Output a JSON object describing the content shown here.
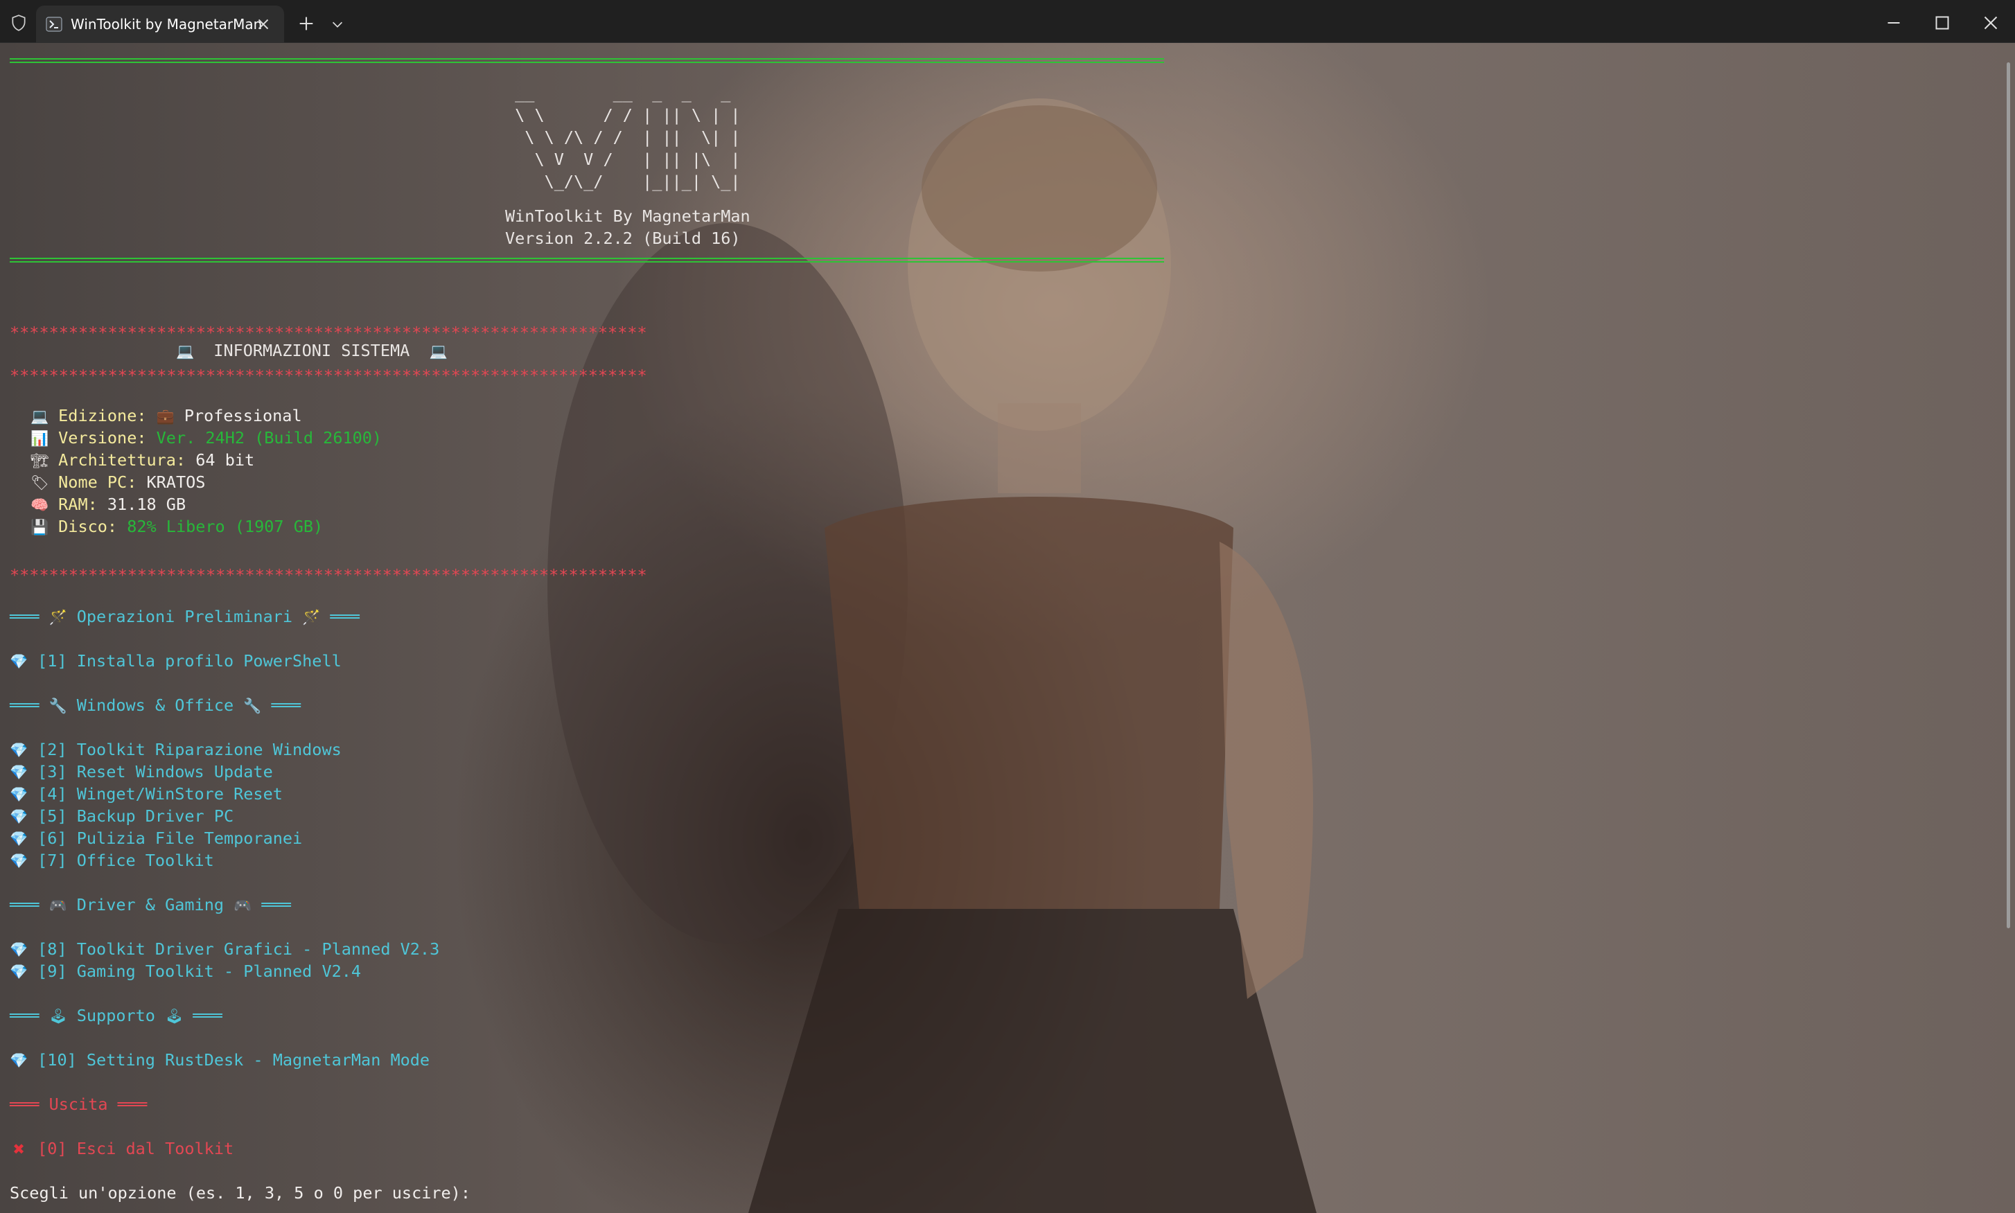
{
  "window": {
    "tab_title": "WinToolkit by MagnetarMan",
    "new_tab": "+",
    "tab_menu": "⌄"
  },
  "banner": {
    "ascii_art": [
      " __        __  _  _   _ ",
      " \\ \\      / / | || \\ | |",
      "  \\ \\ /\\ / /  | ||  \\| |",
      "   \\ V  V /   | || |\\  |",
      "    \\_/\\_/    |_||_| \\_|"
    ],
    "title": "WinToolkit By MagnetarMan",
    "version": "Version 2.2.2 (Build 16)"
  },
  "sysinfo": {
    "stars": "*****************************************************************",
    "heading": "INFORMAZIONI SISTEMA",
    "rows": [
      {
        "icon": "laptop-icon",
        "label": "Edizione:",
        "prefix_icon": "briefcase-icon",
        "value": "Professional",
        "color": "white"
      },
      {
        "icon": "chart-icon",
        "label": "Versione:",
        "value": "Ver. 24H2 (Build 26100)",
        "color": "green"
      },
      {
        "icon": "building-icon",
        "label": "Architettura:",
        "value": "64 bit",
        "color": "white"
      },
      {
        "icon": "label-tag-icon",
        "label": "Nome PC:",
        "value": "KRATOS",
        "color": "white"
      },
      {
        "icon": "brain-icon",
        "label": "RAM:",
        "value": "31.18 GB",
        "color": "white"
      },
      {
        "icon": "disk-icon",
        "label": "Disco:",
        "value": "82% Libero (1907 GB)",
        "color": "green"
      }
    ]
  },
  "menu": {
    "sec_prelim": "Operazioni Preliminari",
    "sec_windows": "Windows & Office",
    "sec_gaming": "Driver & Gaming",
    "sec_support": "Supporto",
    "sec_exit": "Uscita",
    "bars": "═══",
    "items": [
      "[1] Installa profilo PowerShell",
      "[2] Toolkit Riparazione Windows",
      "[3] Reset Windows Update",
      "[4] Winget/WinStore Reset",
      "[5] Backup Driver PC",
      "[6] Pulizia File Temporanei",
      "[7] Office Toolkit",
      "[8] Toolkit Driver Grafici - Planned V2.3",
      "[9] Gaming Toolkit - Planned V2.4",
      "[10] Setting RustDesk - MagnetarMan Mode"
    ],
    "exit_item": "[0] Esci dal Toolkit"
  },
  "prompt": "Scegli un'opzione (es. 1, 3, 5 o 0 per uscire):",
  "colors": {
    "green": "#27b83a",
    "red": "#e34753",
    "cyan": "#4fc6d8",
    "yellow": "#f4ea9d"
  }
}
